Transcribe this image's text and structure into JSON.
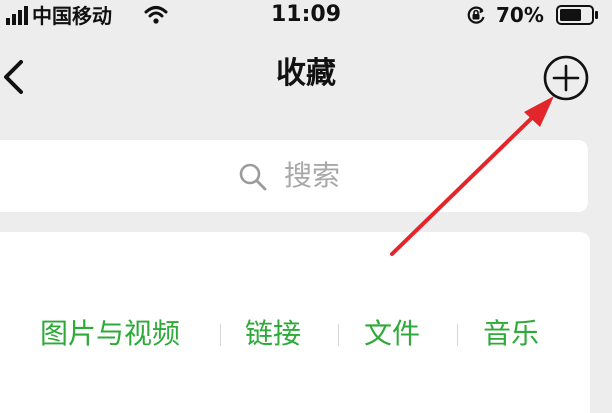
{
  "status_bar": {
    "carrier": "中国移动",
    "time": "11:09",
    "battery_percent": "70%",
    "battery_level": 0.7,
    "icons": [
      "signal-icon",
      "wifi-icon",
      "rotation-lock-icon",
      "battery-icon"
    ]
  },
  "nav": {
    "title": "收藏",
    "back_icon": "chevron-left-icon",
    "add_icon": "plus-circle-icon"
  },
  "search": {
    "placeholder": "搜索",
    "icon": "search-icon"
  },
  "categories": {
    "items": [
      {
        "label": "图片与视频"
      },
      {
        "label": "链接"
      },
      {
        "label": "文件"
      },
      {
        "label": "音乐"
      }
    ]
  },
  "annotation": {
    "arrow_color": "#e2262b",
    "icon": "red-arrow"
  },
  "colors": {
    "background": "#ededed",
    "category_text": "#2eaa39",
    "placeholder_text": "#a8a8a8"
  }
}
